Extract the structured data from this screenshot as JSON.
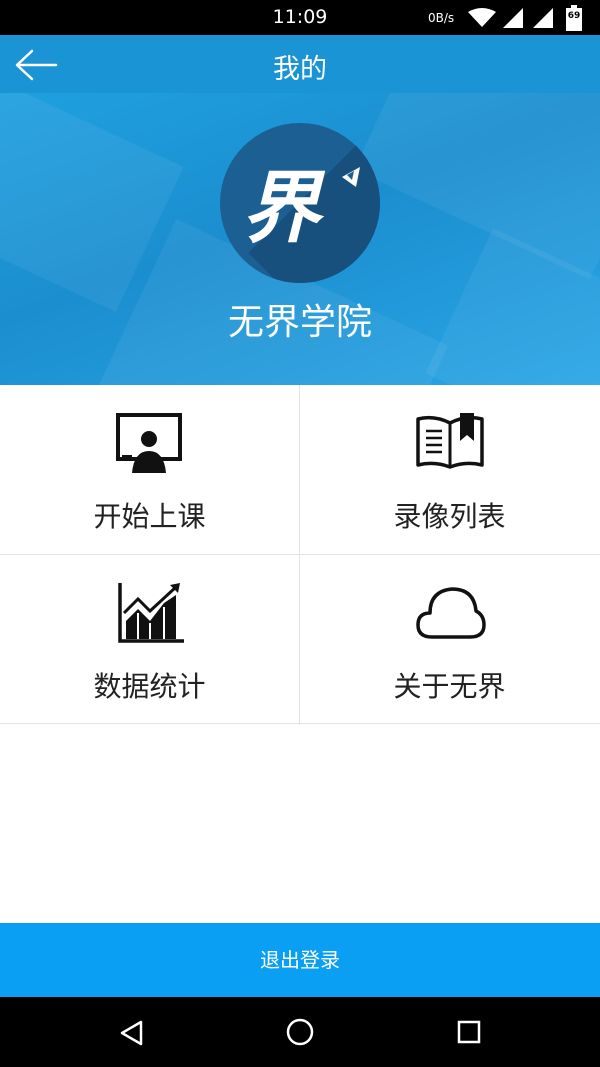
{
  "status_bar": {
    "time": "11:09",
    "net_speed": "0B/s",
    "battery": "69"
  },
  "app_bar": {
    "title": "我的"
  },
  "profile": {
    "name": "无界学院",
    "logo_text": "界"
  },
  "menu": [
    {
      "label": "开始上课",
      "icon": "presentation-icon"
    },
    {
      "label": "录像列表",
      "icon": "book-icon"
    },
    {
      "label": "数据统计",
      "icon": "chart-icon"
    },
    {
      "label": "关于无界",
      "icon": "cloud-icon"
    }
  ],
  "logout_label": "退出登录",
  "colors": {
    "app_bar": "#1a94d4",
    "banner": "#1fa0df",
    "logout": "#0a9ff2",
    "logo_bg": "#1b5f93"
  }
}
